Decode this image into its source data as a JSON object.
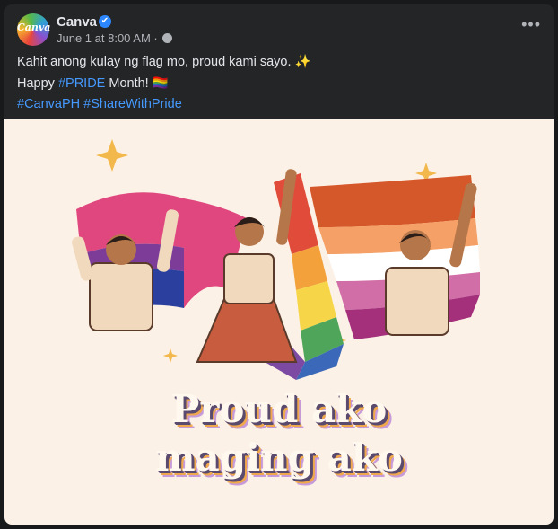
{
  "post": {
    "author": "Canva",
    "avatar_text": "Canva",
    "verified_mark": "✔",
    "timestamp": "June 1 at 8:00 AM",
    "separator": "·",
    "audience_icon": "globe-icon",
    "more_label": "•••",
    "line1": "Kahit anong kulay ng flag mo, proud kami sayo. ✨",
    "line2_prefix": "Happy ",
    "line2_tag": "#PRIDE",
    "line2_suffix": " Month! 🏳️‍🌈",
    "hashtag1": "#CanvaPH",
    "hashtag2": "#ShareWithPride"
  },
  "image": {
    "slogan_line1": "Proud ako",
    "slogan_line2": "maging ako"
  },
  "colors": {
    "card_bg": "#242526",
    "link": "#4599ff",
    "image_bg": "#fcf1e6"
  }
}
